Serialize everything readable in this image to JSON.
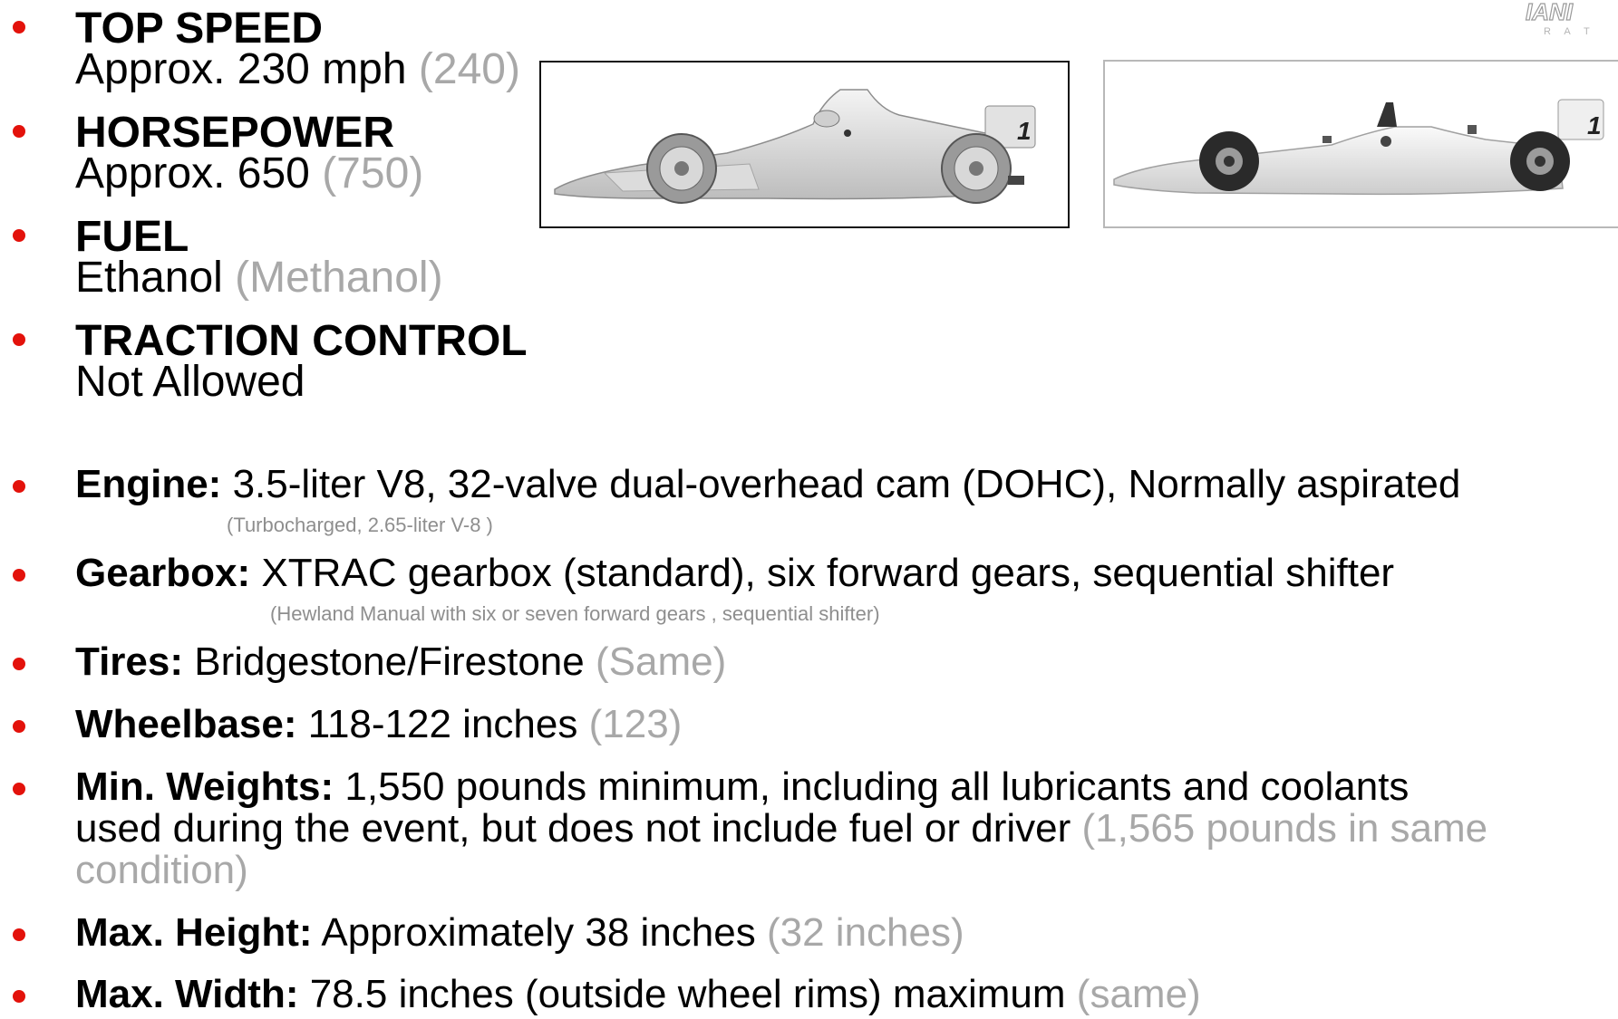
{
  "top_specs": [
    {
      "heading": "TOP SPEED",
      "value": "Approx. 230 mph",
      "alt": "(240)"
    },
    {
      "heading": "HORSEPOWER",
      "value": "Approx. 650",
      "alt": "(750)"
    },
    {
      "heading": "FUEL",
      "value": "Ethanol",
      "alt": "(Methanol)"
    },
    {
      "heading": "TRACTION CONTROL",
      "value": "Not Allowed",
      "alt": ""
    }
  ],
  "specs": {
    "engine": {
      "label": "Engine:",
      "value": "3.5-liter V8, 32-valve dual-overhead cam (DOHC), Normally aspirated",
      "note": "(Turbocharged, 2.65-liter V-8 )"
    },
    "gearbox": {
      "label": "Gearbox:",
      "value": "XTRAC gearbox (standard), six forward gears, sequential shifter",
      "note": "(Hewland Manual with six or seven forward gears , sequential shifter)"
    },
    "tires": {
      "label": "Tires:",
      "value": "Bridgestone/Firestone",
      "alt": "(Same)"
    },
    "wheelbase": {
      "label": "Wheelbase:",
      "value": "118-122 inches",
      "alt": "(123)"
    },
    "weights": {
      "label": "Min. Weights:",
      "value_line1": "1,550 pounds minimum, including all lubricants and coolants",
      "value_line2": "used during the event, but does not include fuel or driver",
      "alt_line2": "(1,565 pounds in same",
      "alt_line3": "condition)"
    },
    "height": {
      "label": "Max. Height:",
      "value": "Approximately 38 inches",
      "alt": "(32 inches)"
    },
    "width": {
      "label": "Max. Width:",
      "value": "78.5 inches (outside wheel rims) maximum",
      "alt": "(same)"
    }
  },
  "car_number": "1",
  "logo_text": "IANI",
  "colors": {
    "bullet": "#e3120b",
    "alt_text": "#a8a8a8"
  }
}
